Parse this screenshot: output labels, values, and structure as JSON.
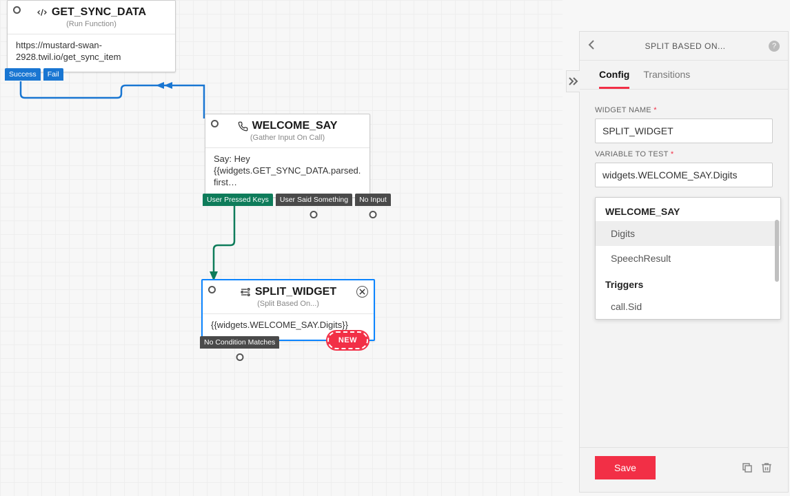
{
  "canvas": {
    "nodes": {
      "get_sync": {
        "title": "GET_SYNC_DATA",
        "subtype": "(Run Function)",
        "body": "https://mustard-swan-2928.twil.io/get_sync_item",
        "outcomes": {
          "success": "Success",
          "fail": "Fail"
        }
      },
      "welcome": {
        "title": "WELCOME_SAY",
        "subtype": "(Gather Input On Call)",
        "body": "Say: Hey {{widgets.GET_SYNC_DATA.parsed.first…",
        "outcomes": {
          "keys": "User Pressed Keys",
          "said": "User Said Something",
          "noinput": "No Input"
        }
      },
      "split": {
        "title": "SPLIT_WIDGET",
        "subtype": "(Split Based On...)",
        "body": "{{widgets.WELCOME_SAY.Digits}}",
        "outcomes": {
          "nomatch": "No Condition Matches"
        },
        "new_label": "NEW"
      }
    }
  },
  "panel": {
    "title": "SPLIT BASED ON...",
    "tabs": {
      "config": "Config",
      "transitions": "Transitions"
    },
    "fields": {
      "widget_name": {
        "label": "WIDGET NAME",
        "value": "SPLIT_WIDGET"
      },
      "variable": {
        "label": "VARIABLE TO TEST",
        "value": "widgets.WELCOME_SAY.Digits"
      }
    },
    "dropdown": {
      "group1": "WELCOME_SAY",
      "item1": "Digits",
      "item2": "SpeechResult",
      "group2": "Triggers",
      "item3": "call.Sid"
    },
    "save": "Save"
  }
}
